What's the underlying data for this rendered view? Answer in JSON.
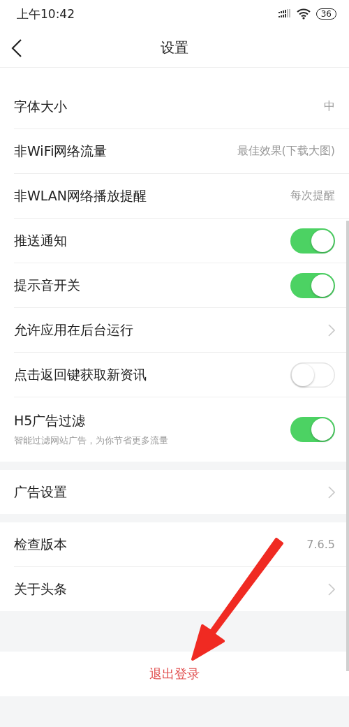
{
  "status_bar": {
    "time": "上午10:42",
    "battery": "36"
  },
  "header": {
    "title": "设置"
  },
  "groups": [
    {
      "items": [
        {
          "kind": "value",
          "label": "字体大小",
          "value": "中"
        },
        {
          "kind": "value",
          "label": "非WiFi网络流量",
          "value": "最佳效果(下载大图)"
        },
        {
          "kind": "value",
          "label": "非WLAN网络播放提醒",
          "value": "每次提醒"
        },
        {
          "kind": "toggle",
          "label": "推送通知",
          "on": true
        },
        {
          "kind": "toggle",
          "label": "提示音开关",
          "on": true
        },
        {
          "kind": "link",
          "label": "允许应用在后台运行"
        },
        {
          "kind": "toggle",
          "label": "点击返回键获取新资讯",
          "on": false
        },
        {
          "kind": "toggle",
          "label": "H5广告过滤",
          "subtitle": "智能过滤网站广告，为你节省更多流量",
          "on": true
        }
      ]
    },
    {
      "items": [
        {
          "kind": "link",
          "label": "广告设置"
        }
      ]
    },
    {
      "items": [
        {
          "kind": "value",
          "label": "检查版本",
          "value": "7.6.5"
        },
        {
          "kind": "link",
          "label": "关于头条"
        }
      ]
    }
  ],
  "logout": {
    "label": "退出登录"
  }
}
